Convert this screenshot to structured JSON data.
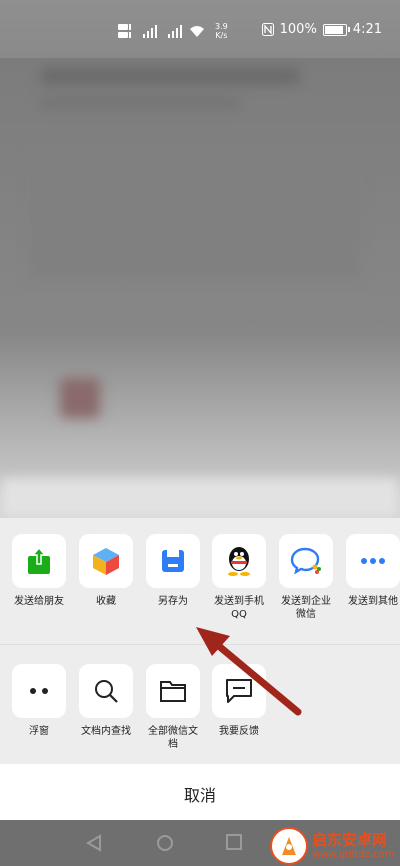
{
  "status_bar": {
    "network_rate": "3.9",
    "network_unit": "K/s",
    "battery": "100%",
    "time": "4:21",
    "battery_level": 1.0
  },
  "share_row": [
    {
      "label": "发送给朋友",
      "icon": "share-upload-icon",
      "color": "#1aad19"
    },
    {
      "label": "收藏",
      "icon": "favorite-cube-icon",
      "color": "#f2b21b"
    },
    {
      "label": "另存为",
      "icon": "save-disk-icon",
      "color": "#2e7cf6"
    },
    {
      "label": "发送到手机\nQQ",
      "icon": "qq-penguin-icon",
      "color": "#000000"
    },
    {
      "label": "发送到企业\n微信",
      "icon": "wecom-icon",
      "color": "#2e7cf6"
    },
    {
      "label": "发送到其他",
      "icon": "more-dots-icon",
      "color": "#2e7cf6"
    }
  ],
  "action_row": [
    {
      "label": "浮窗",
      "icon": "float-window-icon"
    },
    {
      "label": "文档内查找",
      "icon": "search-icon"
    },
    {
      "label": "全部微信文\n档",
      "icon": "folder-icon"
    },
    {
      "label": "我要反馈",
      "icon": "feedback-icon"
    }
  ],
  "cancel_label": "取消",
  "annotation_color": "#a0261c",
  "watermark": {
    "title": "启东安卓网",
    "url": "www.qdltdz.com"
  }
}
